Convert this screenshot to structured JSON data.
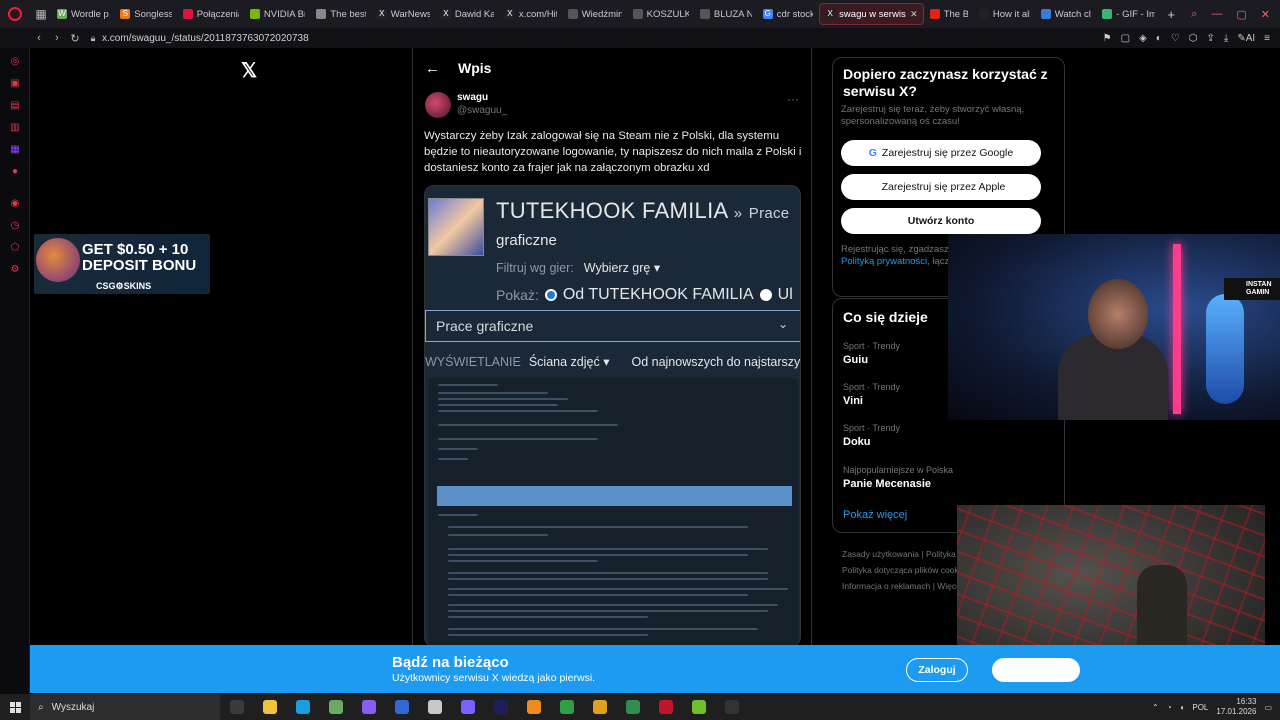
{
  "browser": {
    "tabs": [
      {
        "label": "Wordle pl",
        "fav": "W",
        "color": "#6aaa64"
      },
      {
        "label": "Songless",
        "fav": "S",
        "color": "#e87a1e"
      },
      {
        "label": "Połączenia",
        "fav": "",
        "color": "#dc143c"
      },
      {
        "label": "NVIDIA Br",
        "fav": "",
        "color": "#76b900"
      },
      {
        "label": "The best",
        "fav": "",
        "color": "#888"
      },
      {
        "label": "WarNews",
        "fav": "X",
        "color": "#222"
      },
      {
        "label": "Dawid Ka",
        "fav": "X",
        "color": "#222"
      },
      {
        "label": "x.com/Hit",
        "fav": "X",
        "color": "#222"
      },
      {
        "label": "Wiedźmin",
        "fav": "",
        "color": "#555"
      },
      {
        "label": "KOSZULK",
        "fav": "",
        "color": "#555"
      },
      {
        "label": "BLUZA N",
        "fav": "",
        "color": "#555"
      },
      {
        "label": "cdr stock",
        "fav": "G",
        "color": "#4285f4"
      },
      {
        "label": "swagu w serwisie",
        "fav": "X",
        "color": "#222",
        "active": true
      },
      {
        "label": "The B",
        "fav": "",
        "color": "#e62117"
      },
      {
        "label": "How it all",
        "fav": "",
        "color": "#222"
      },
      {
        "label": "Watch cli",
        "fav": "",
        "color": "#3b7bd8"
      },
      {
        "label": "- GIF - Im",
        "fav": "",
        "color": "#3cb371"
      }
    ],
    "url": "x.com/swaguu_/status/2011873763072020738"
  },
  "promo": {
    "line1": "GET $0.50 + 10",
    "line2": "DEPOSIT BONU",
    "brand": "CSG⚙SKINS"
  },
  "post": {
    "header": "Wpis",
    "author_name": "swagu",
    "author_handle": "@swaguu_",
    "text": "Wystarczy żeby Izak zalogował się na Steam nie z Polski, dla systemu będzie to nieautoryzowane logowanie, ty napiszesz do nich maila z Polski i dostaniesz konto za frajer jak na załączonym obrazku xd",
    "media": {
      "group": "TUTEKHOOK FAMILIA",
      "sep": "»",
      "sub": "Prace",
      "section": "graficzne",
      "filter_label": "Filtruj wg gier:",
      "filter_value": "Wybierz grę ▾",
      "show_label": "Pokaż:",
      "show_opt1": "Od TUTEKHOOK FAMILIA",
      "show_opt2": "Ul",
      "dropdown": "Prace graficzne",
      "view_label": "WYŚWIETLANIE",
      "view_opt1": "Ściana zdjęć ▾",
      "view_opt2": "Od najnowszych do najstarszych ▾"
    }
  },
  "signup": {
    "title": "Dopiero zaczynasz korzystać z serwisu X?",
    "desc": "Zarejestruj się teraz, żeby stworzyć własną, spersonalizowaną oś czasu!",
    "google": "Zarejestruj się przez Google",
    "apple": "Zarejestruj się przez Apple",
    "create": "Utwórz konto",
    "legal": "Rejestrując się, zgadzasz się",
    "privacy": "Polityką prywatności",
    "legal2": ", łączn"
  },
  "trends": {
    "title": "Co się dzieje",
    "items": [
      {
        "cat": "Sport · Trendy",
        "name": "Guiu"
      },
      {
        "cat": "Sport · Trendy",
        "name": "Vini"
      },
      {
        "cat": "Sport · Trendy",
        "name": "Doku"
      },
      {
        "cat": "Najpopularniejsze w Polska",
        "name": "Panie Mecenasie"
      }
    ],
    "more": "Pokaż więcej"
  },
  "footer": {
    "l1": "Zasady użytkowania  |  Polityka p",
    "l2": "Polityka dotycząca plików cookie",
    "l3": "Informacja o reklamach  |  Więce"
  },
  "banner": {
    "title": "Bądź na bieżąco",
    "sub": "Użytkownicy serwisu X wiedzą jako pierwsi.",
    "login": "Zaloguj"
  },
  "cam": {
    "logo": "INSTAN GAMIN"
  },
  "taskbar": {
    "search": "Wyszukaj",
    "lang": "POL",
    "time": "16:33",
    "date": "17.01.2026",
    "apps": [
      "#3a3a3a",
      "#f2c23a",
      "#1b9de2",
      "#6aaa64",
      "#8a5cf6",
      "#2e6ad6",
      "#c8c8c8",
      "#7b61ff",
      "#1e1e5a",
      "#f08c1e",
      "#2ea043",
      "#e0a020",
      "#2f8f4f",
      "#c0152a",
      "#6fbf2a",
      "#333"
    ]
  }
}
